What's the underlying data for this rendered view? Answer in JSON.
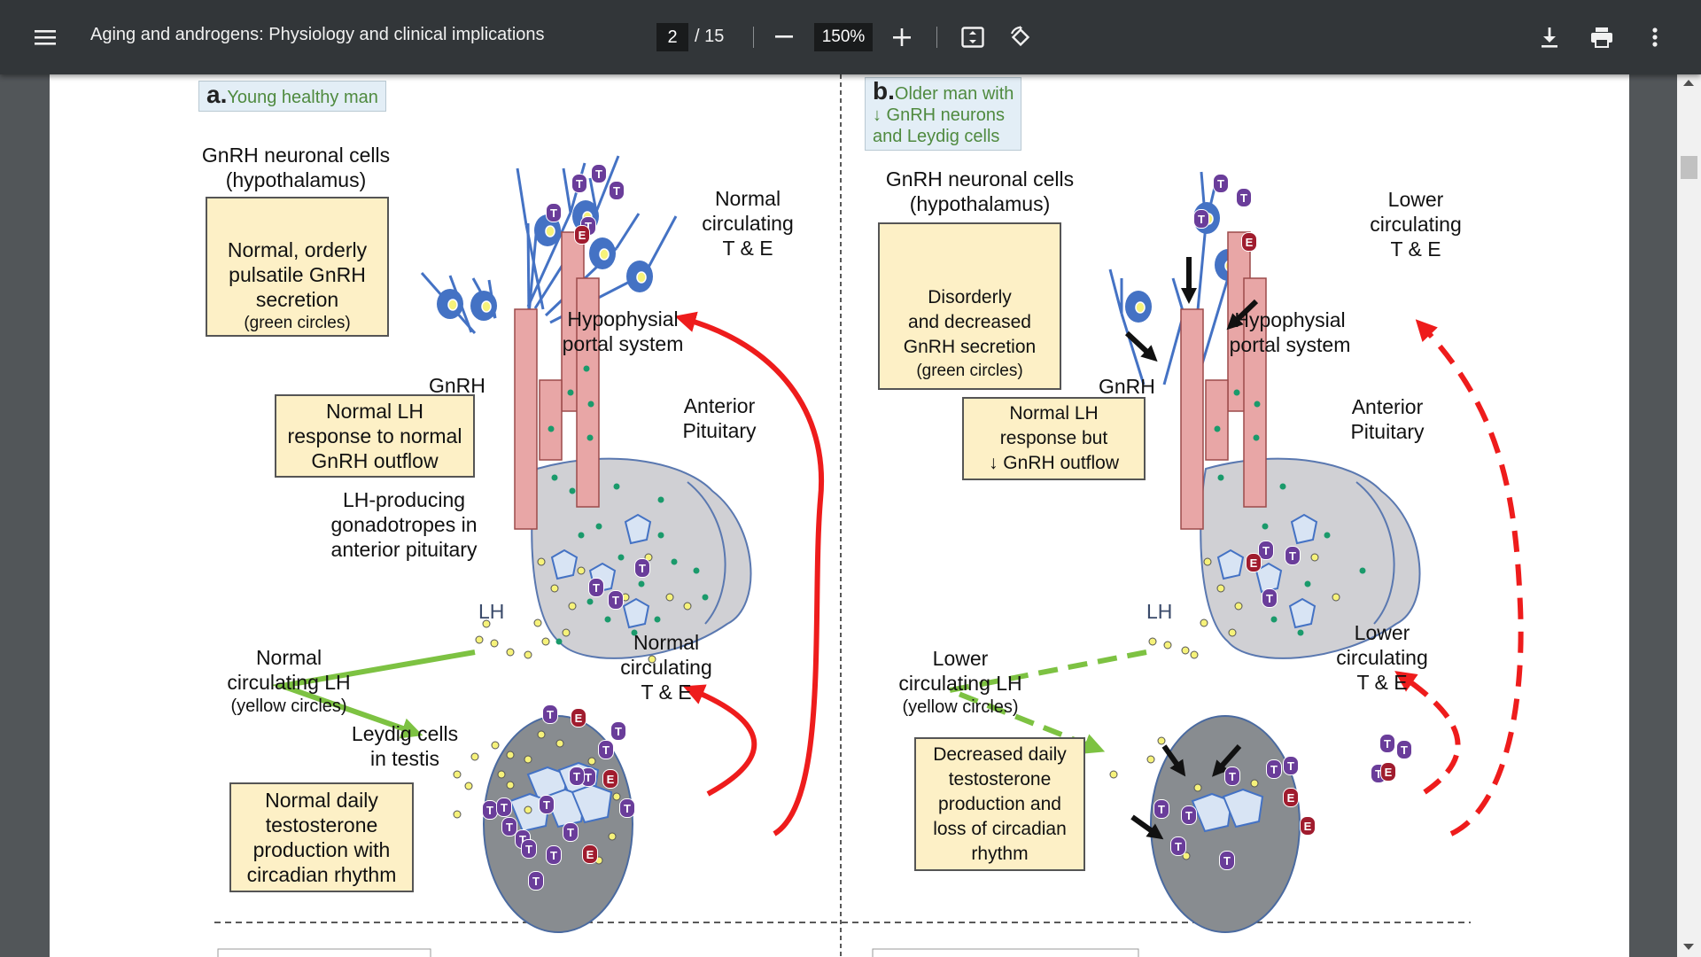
{
  "toolbar": {
    "menu_icon": "hamburger-menu-icon",
    "title": "Aging and androgens: Physiology and clinical implications",
    "page_current": "2",
    "page_total": "/ 15",
    "zoom": "150%",
    "icons": [
      "minus-icon",
      "plus-icon",
      "fit-page-icon",
      "rotate-icon",
      "download-icon",
      "print-icon",
      "more-vert-icon"
    ]
  },
  "figure": {
    "panel_a": {
      "letter": "a.",
      "heading": "Young healthy man",
      "gnrh_cells": [
        "GnRH neuronal cells",
        "(hypothalamus)"
      ],
      "secretion_box": [
        "Normal, orderly",
        "pulsatile GnRH",
        "secretion",
        "(green circles)"
      ],
      "gnrh_label": "GnRH",
      "portal": [
        "Hypophysial",
        "portal system"
      ],
      "pituitary": [
        "Anterior",
        "Pituitary"
      ],
      "lh_response_box": [
        "Normal LH",
        "response to normal",
        "GnRH outflow"
      ],
      "gonadotropes": [
        "LH-producing",
        "gonadotropes in",
        "anterior pituitary"
      ],
      "lh_label": "LH",
      "circ_te_top": [
        "Normal",
        "circulating",
        "T & E"
      ],
      "circ_lh": [
        "Normal",
        "circulating LH",
        "(yellow circles)"
      ],
      "leydig": [
        "Leydig cells",
        "in testis"
      ],
      "circ_te_bottom": [
        "Normal",
        "circulating",
        "T & E"
      ],
      "testosterone_box": [
        "Normal daily",
        "testosterone",
        "production with",
        "circadian rhythm"
      ]
    },
    "panel_b": {
      "letter": "b.",
      "heading": [
        "Older man  with",
        "↓ GnRH neurons",
        "and Leydig cells"
      ],
      "gnrh_cells": [
        "GnRH neuronal cells",
        "(hypothalamus)"
      ],
      "secretion_box": [
        "Disorderly",
        "and decreased",
        "GnRH secretion",
        "(green circles)"
      ],
      "gnrh_label": "GnRH",
      "portal": [
        "Hypophysial",
        "portal system"
      ],
      "pituitary": [
        "Anterior",
        "Pituitary"
      ],
      "lh_response_box": [
        "Normal LH",
        "response but",
        "↓ GnRH outflow"
      ],
      "lh_label": "LH",
      "circ_te_top": [
        "Lower",
        "circulating",
        "T & E"
      ],
      "circ_lh": [
        "Lower",
        "circulating LH",
        "(yellow circles)"
      ],
      "circ_te_bottom": [
        "Lower",
        "circulating",
        "T & E"
      ],
      "testosterone_box": [
        "Decreased daily",
        "testosterone",
        "production and",
        "loss of circadian",
        "rhythm"
      ]
    },
    "markers": {
      "t": "T",
      "e": "E"
    }
  },
  "colors": {
    "toolbar": "#323639",
    "viewer_bg": "#525659",
    "neuron_blue": "#4472c4",
    "portal_pink": "#e8a6a6",
    "gnrh_green": "#1a9a6b",
    "lh_yellow": "#f6f27a",
    "arrow_red": "#ee1c1c",
    "arrow_green": "#7dc242",
    "t_purple": "#6a3d9a",
    "e_red": "#a01c2e",
    "box_fill": "#fdf0c6"
  }
}
